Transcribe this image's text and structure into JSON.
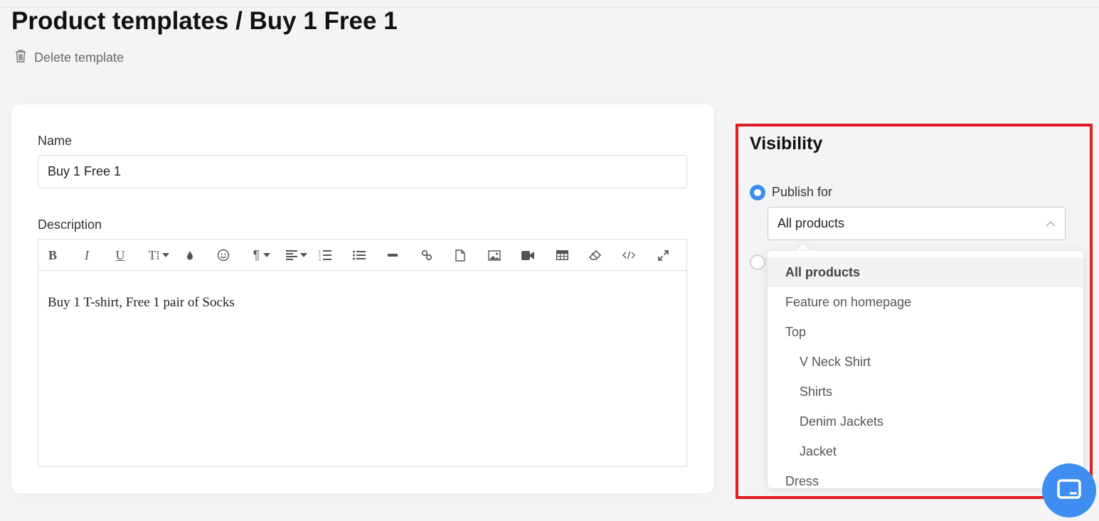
{
  "header": {
    "title": "Product templates / Buy 1 Free 1",
    "delete_label": "Delete template"
  },
  "form": {
    "name_label": "Name",
    "name_value": "Buy 1 Free 1",
    "description_label": "Description",
    "description_text": "Buy 1 T-shirt, Free 1 pair of Socks"
  },
  "editor_toolbar": [
    {
      "icon": "bold-icon",
      "glyph": "B"
    },
    {
      "icon": "italic-icon",
      "glyph": "I"
    },
    {
      "icon": "underline-icon",
      "glyph": "U"
    },
    {
      "icon": "font-size-icon",
      "glyph": "T⁞"
    },
    {
      "icon": "text-color-icon"
    },
    {
      "icon": "emoji-icon"
    },
    {
      "icon": "paragraph-format-icon",
      "glyph": "¶"
    },
    {
      "icon": "align-icon"
    },
    {
      "icon": "ordered-list-icon"
    },
    {
      "icon": "unordered-list-icon"
    },
    {
      "icon": "horizontal-line-icon"
    },
    {
      "icon": "link-icon"
    },
    {
      "icon": "file-icon"
    },
    {
      "icon": "image-icon"
    },
    {
      "icon": "video-icon"
    },
    {
      "icon": "table-icon"
    },
    {
      "icon": "clear-formatting-icon"
    },
    {
      "icon": "code-view-icon"
    },
    {
      "icon": "fullscreen-icon"
    }
  ],
  "visibility": {
    "title": "Visibility",
    "publish_for_label": "Publish for",
    "selected_option": "All products",
    "options": [
      {
        "label": "All products",
        "level": 0,
        "selected": true
      },
      {
        "label": "Feature on homepage",
        "level": 0
      },
      {
        "label": "Top",
        "level": 0
      },
      {
        "label": "V Neck Shirt",
        "level": 1
      },
      {
        "label": "Shirts",
        "level": 1
      },
      {
        "label": "Denim Jackets",
        "level": 1
      },
      {
        "label": "Jacket",
        "level": 1
      },
      {
        "label": "Dress",
        "level": 0
      }
    ]
  },
  "colors": {
    "accent": "#3d8ef0",
    "highlight_border": "#e31b23",
    "background": "#f4f4f6"
  }
}
